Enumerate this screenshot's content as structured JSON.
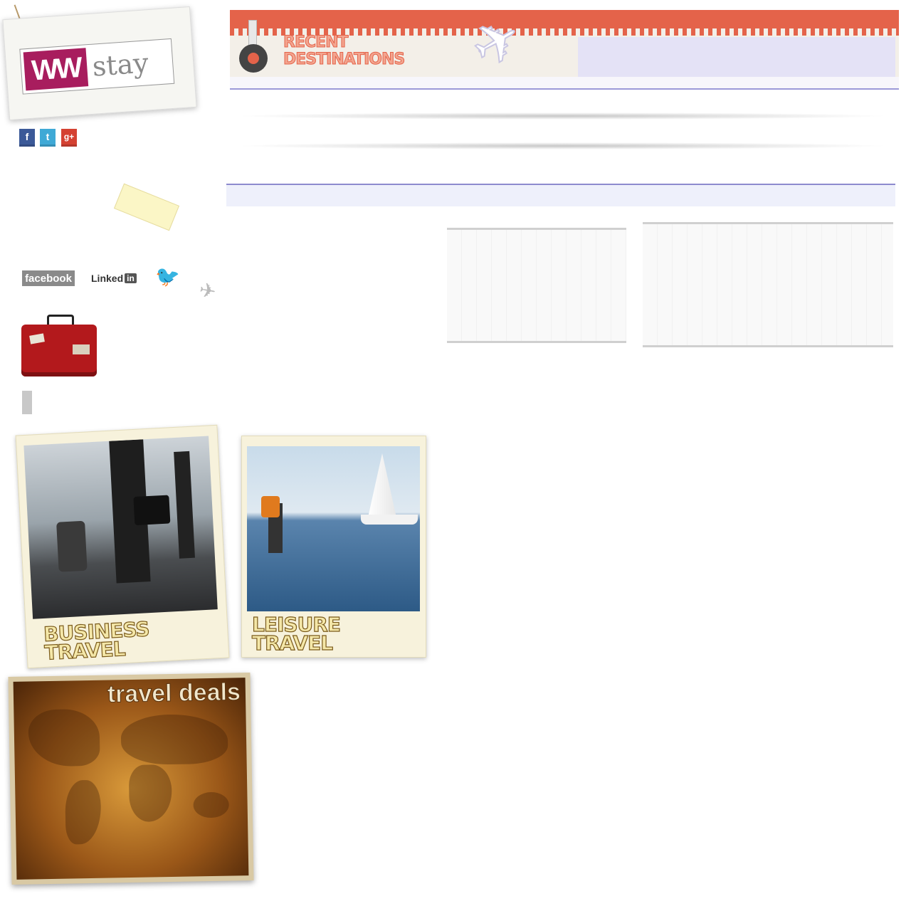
{
  "logo": {
    "ww": "WW",
    "stay": "stay"
  },
  "social_small": [
    {
      "name": "facebook",
      "glyph": "f",
      "color": "#3b5998"
    },
    {
      "name": "twitter",
      "glyph": "t",
      "color": "#3fa9d6"
    },
    {
      "name": "google-plus",
      "glyph": "g+",
      "color": "#d44132"
    }
  ],
  "banner": {
    "title_line1": "RECENT",
    "title_line2": "DESTINATIONS"
  },
  "social_text": {
    "facebook": "facebook",
    "linkedin": "Linked",
    "linkedin_in": "in"
  },
  "polaroids": [
    {
      "line1": "BUSINESS",
      "line2": "TRAVEL"
    },
    {
      "line1": "LEISURE",
      "line2": "TRAVEL"
    }
  ],
  "deals": {
    "title": "travel deals"
  },
  "colors": {
    "brand": "#a81d5e",
    "banner_accent": "#e4634a",
    "lavender": "#e4e2f6"
  }
}
